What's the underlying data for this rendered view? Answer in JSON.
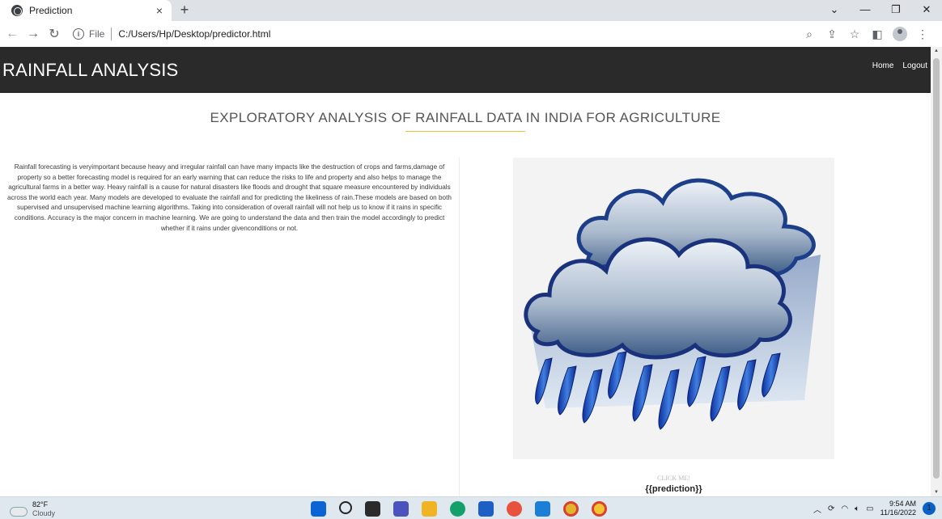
{
  "browser": {
    "tab_title": "Prediction",
    "tab_close": "×",
    "new_tab": "+",
    "scheme": "File",
    "url": "C:/Users/Hp/Desktop/predictor.html",
    "window_controls": [
      "⌄",
      "—",
      "❐",
      "✕"
    ]
  },
  "site": {
    "brand": "RAINFALL ANALYSIS",
    "nav": [
      "Home",
      "Logout"
    ],
    "heading": "EXPLORATORY ANALYSIS OF RAINFALL DATA IN INDIA FOR AGRICULTURE",
    "description": "Rainfall forecasting is veryimportant because heavy and irregular rainfall can have many impacts like the destruction of crops and farms,damage of property so a better forecasting model is required for an early warning that can reduce the risks to life and property and also helps to manage the agricultural farms in a better way. Heavy rainfall is a cause for natural disasters like floods and drought that square measure encountered by individuals across the world each year. Many models are developed to evaluate the rainfall and for predicting the likeliness of rain.These models are based on both supervised and unsupervised machine learning algorithms. Taking into consideration of overall rainfall will not help us to know if it rains in specific conditions. Accuracy is the major concern in machine learning. We are going to understand the data and then train the model accordingly to predict whether if it rains under givenconditions or not.",
    "click_me": "CLICK ME!",
    "prediction": "{{prediction}}"
  },
  "taskbar": {
    "temperature": "82°F",
    "condition": "Cloudy",
    "time": "9:54 AM",
    "date": "11/16/2022",
    "notifications": "1"
  },
  "colors": {
    "nav_bg": "#2a2a2a",
    "heading_underline": "#e5c23c",
    "tab_strip": "#dee1e6"
  }
}
